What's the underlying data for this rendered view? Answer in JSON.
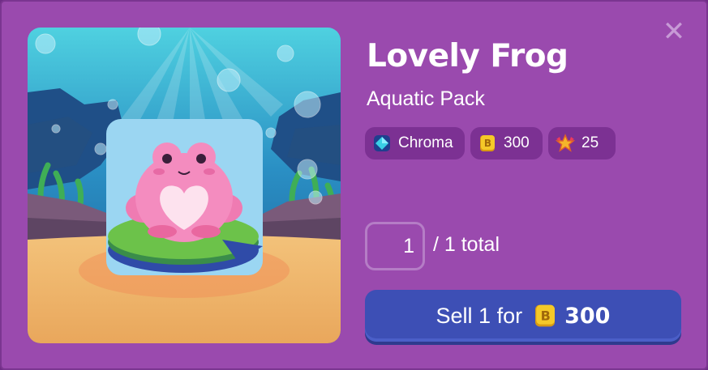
{
  "item": {
    "name": "Lovely Frog",
    "pack": "Aquatic Pack"
  },
  "tags": [
    {
      "label": "Chroma",
      "icon": "chroma-gem-icon"
    },
    {
      "label": "300",
      "icon": "token-icon"
    },
    {
      "label": "25",
      "icon": "star-badge-icon"
    }
  ],
  "quantity": {
    "value": "1",
    "total_text": "/ 1 total"
  },
  "sell_button": {
    "label": "Sell 1 for",
    "icon": "token-icon",
    "amount": "300"
  },
  "close_icon": "close-icon",
  "colors": {
    "panel": "#9a4aae",
    "chip": "#7c3193",
    "button": "#3d4fb5",
    "token": "#f2c21b"
  }
}
